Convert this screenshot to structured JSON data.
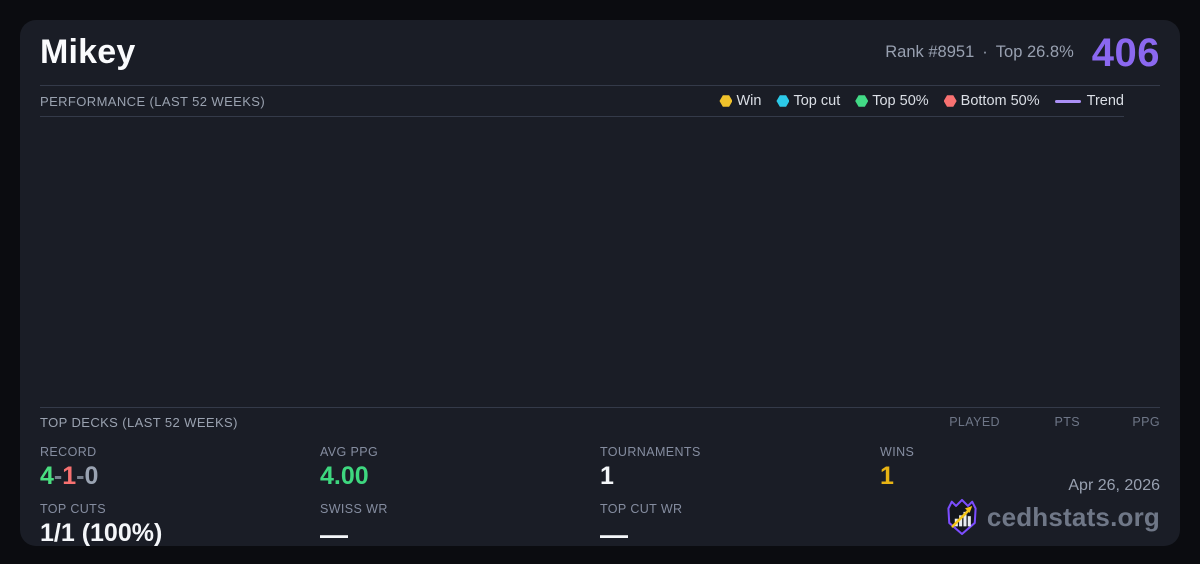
{
  "colors": {
    "accent_purple": "#8b68f0",
    "trend_purple": "#ab90f6",
    "win_yellow": "#f0c22b",
    "topcut_cyan": "#2cc9e8",
    "top50_green": "#42da86",
    "bottom50_red": "#f87171",
    "record_green": "#4ade80",
    "record_red": "#f87171",
    "record_gray": "#9aa3b2",
    "record_dash_gray": "#79818f",
    "ppg_green": "#3ed77f",
    "wins_gold": "#e8b414"
  },
  "header": {
    "player_name": "Mikey",
    "rank": "Rank #8951",
    "dot_separator": "·",
    "top_percent": "Top 26.8%",
    "score": "406"
  },
  "performance": {
    "title": "PERFORMANCE (LAST 52 WEEKS)",
    "legend": [
      {
        "label": "Win",
        "color": "#f0c22b"
      },
      {
        "label": "Top cut",
        "color": "#2cc9e8"
      },
      {
        "label": "Top 50%",
        "color": "#42da86"
      },
      {
        "label": "Bottom 50%",
        "color": "#f87171"
      }
    ],
    "trend_label": "Trend"
  },
  "top_decks": {
    "title": "TOP DECKS (LAST 52 WEEKS)",
    "columns": [
      "PLAYED",
      "PTS",
      "PPG"
    ]
  },
  "stats": {
    "record": {
      "label": "RECORD",
      "wins": "4",
      "losses": "1",
      "draws": "0",
      "dash": "-"
    },
    "avg_ppg": {
      "label": "AVG PPG",
      "value": "4.00"
    },
    "tournaments": {
      "label": "TOURNAMENTS",
      "value": "1"
    },
    "wins": {
      "label": "WINS",
      "value": "1"
    },
    "top_cuts": {
      "label": "TOP CUTS",
      "value": "1/1 (100%)"
    },
    "swiss_wr": {
      "label": "SWISS WR",
      "value": "—"
    },
    "top_cut_wr": {
      "label": "TOP CUT WR",
      "value": "—"
    }
  },
  "footer": {
    "date": "Apr 26, 2026",
    "brand": "cedhstats.org"
  }
}
